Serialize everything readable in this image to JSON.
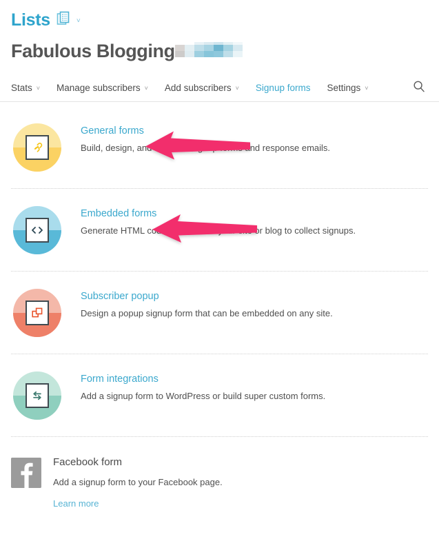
{
  "header": {
    "lists_label": "Lists",
    "lists_icon": "documents-stack-icon",
    "lists_caret": "˅",
    "list_name": "Fabulous Blogging",
    "redacted_suffix": "redacted-blur-block"
  },
  "nav": {
    "items": [
      {
        "label": "Stats",
        "has_caret": true,
        "active": false
      },
      {
        "label": "Manage subscribers",
        "has_caret": true,
        "active": false
      },
      {
        "label": "Add subscribers",
        "has_caret": true,
        "active": false
      },
      {
        "label": "Signup forms",
        "has_caret": false,
        "active": true
      },
      {
        "label": "Settings",
        "has_caret": true,
        "active": false
      }
    ],
    "caret_glyph": "˅",
    "search_icon": "search-icon",
    "active_color": "#3ba8cd"
  },
  "forms": [
    {
      "title": "General forms",
      "description": "Build, design, and translate signup forms and response emails.",
      "icon": "link-icon",
      "badge_top": "#FBE6A0",
      "badge_bottom": "#FBD263",
      "glyph_color": "#F5C518"
    },
    {
      "title": "Embedded forms",
      "description": "Generate HTML code to embed in your site or blog to collect signups.",
      "icon": "code-brackets-icon",
      "badge_top": "#A9DCEC",
      "badge_bottom": "#59B9D8",
      "glyph_color": "#2F4A57"
    },
    {
      "title": "Subscriber popup",
      "description": "Design a popup signup form that can be embedded on any site.",
      "icon": "popup-windows-icon",
      "badge_top": "#F4B8A9",
      "badge_bottom": "#EE8068",
      "glyph_color": "#E8532B"
    },
    {
      "title": "Form integrations",
      "description": "Add a signup form to WordPress or build super custom forms.",
      "icon": "exchange-arrows-icon",
      "badge_top": "#C3E6DB",
      "badge_bottom": "#8FCFBE",
      "glyph_color": "#3E7B70"
    }
  ],
  "facebook": {
    "logo_icon": "facebook-logo-icon",
    "title": "Facebook form",
    "description": "Add a signup form to your Facebook page.",
    "link_label": "Learn more"
  },
  "annotations": {
    "arrow_color": "#F22D6C",
    "arrows": [
      {
        "name": "arrow-to-general-forms",
        "target": "General forms"
      },
      {
        "name": "arrow-to-embedded-forms",
        "target": "Embedded forms"
      }
    ]
  }
}
